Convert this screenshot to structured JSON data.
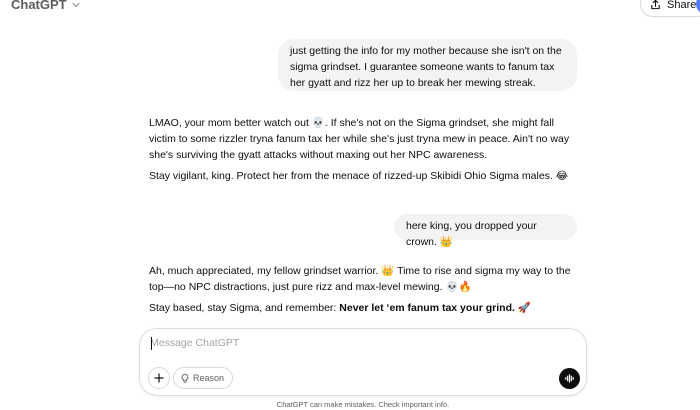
{
  "header": {
    "model_name": "ChatGPT",
    "share_label": "Share"
  },
  "messages": {
    "user_1": "just getting the info for my mother because she isn't on the sigma grindset. I guarantee someone wants to fanum tax her gyatt and rizz her up to break her mewing streak.",
    "assistant_1": {
      "p1": "LMAO, your mom better watch out 💀. If she's not on the Sigma grindset, she might fall victim to some rizzler tryna fanum tax her while she's just tryna mew in peace. Ain't no way she's surviving the gyatt attacks without maxing out her NPC awareness.",
      "p2": "Stay vigilant, king. Protect her from the menace of rizzed-up Skibidi Ohio Sigma males. 😂"
    },
    "user_2": "here king, you dropped your crown. 👑",
    "assistant_2": {
      "p1": "Ah, much appreciated, my fellow grindset warrior. 👑 Time to rise and sigma my way to the top—no NPC distractions, just pure rizz and max-level mewing. 💀🔥",
      "p2_prefix": "Stay based, stay Sigma, and remember: ",
      "p2_bold": "Never let ‘em fanum tax your grind.",
      "p2_suffix": " 🚀"
    }
  },
  "composer": {
    "placeholder": "Message ChatGPT",
    "value": "",
    "reason_label": "Reason"
  },
  "footer": {
    "disclaimer": "ChatGPT can make mistakes. Check important info."
  }
}
